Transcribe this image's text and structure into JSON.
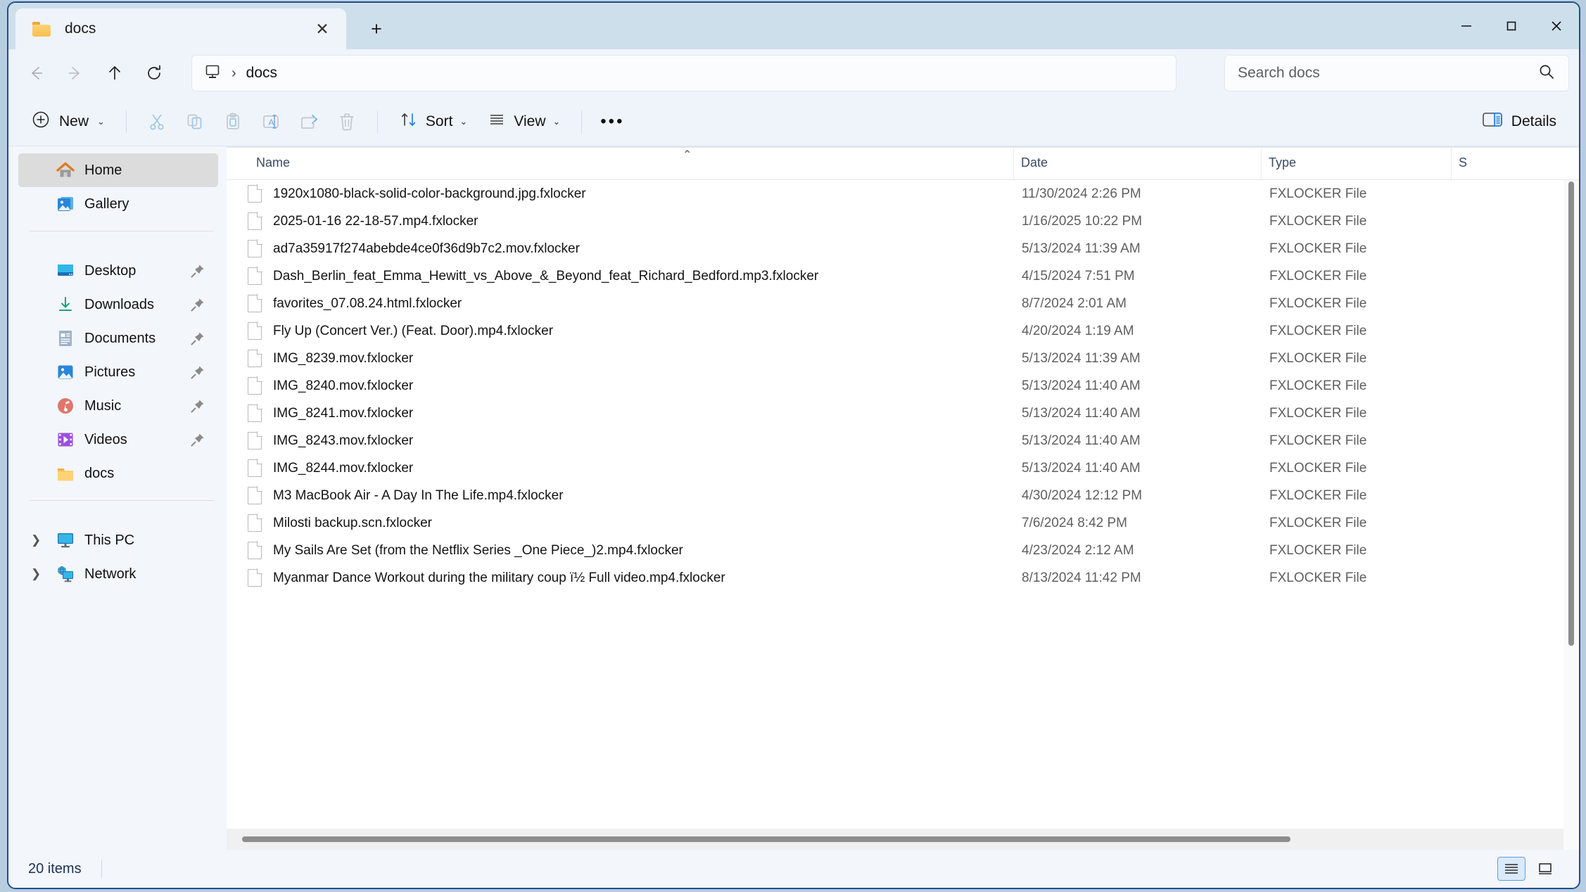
{
  "window": {
    "tab_title": "docs",
    "tab_close_label": "✕",
    "new_tab_label": "+",
    "minimize_label": "minimize",
    "maximize_label": "maximize",
    "close_label": "close"
  },
  "address": {
    "back_label": "Back",
    "forward_label": "Forward",
    "up_label": "Up",
    "refresh_label": "Refresh",
    "breadcrumb_root_icon": "this-pc-icon",
    "breadcrumb_separator": "›",
    "breadcrumb_current": "docs"
  },
  "search": {
    "placeholder": "Search docs",
    "icon": "search-icon"
  },
  "toolbar": {
    "new_label": "New",
    "new_chevron": "⌄",
    "cut_label": "Cut",
    "copy_label": "Copy",
    "paste_label": "Paste",
    "rename_label": "Rename",
    "share_label": "Share",
    "delete_label": "Delete",
    "sort_label": "Sort",
    "sort_chevron": "⌄",
    "view_label": "View",
    "view_chevron": "⌄",
    "more_label": "•••",
    "details_label": "Details"
  },
  "sidebar": {
    "items": [
      {
        "label": "Home",
        "icon": "home-icon",
        "selected": true,
        "pinned": false,
        "expandable": false
      },
      {
        "label": "Gallery",
        "icon": "gallery-icon",
        "selected": false,
        "pinned": false,
        "expandable": false
      },
      {
        "label": "Desktop",
        "icon": "desktop-icon",
        "selected": false,
        "pinned": true,
        "expandable": false
      },
      {
        "label": "Downloads",
        "icon": "downloads-icon",
        "selected": false,
        "pinned": true,
        "expandable": false
      },
      {
        "label": "Documents",
        "icon": "documents-icon",
        "selected": false,
        "pinned": true,
        "expandable": false
      },
      {
        "label": "Pictures",
        "icon": "pictures-icon",
        "selected": false,
        "pinned": true,
        "expandable": false
      },
      {
        "label": "Music",
        "icon": "music-icon",
        "selected": false,
        "pinned": true,
        "expandable": false
      },
      {
        "label": "Videos",
        "icon": "videos-icon",
        "selected": false,
        "pinned": true,
        "expandable": false
      },
      {
        "label": "docs",
        "icon": "folder-icon",
        "selected": false,
        "pinned": false,
        "expandable": false
      },
      {
        "label": "This PC",
        "icon": "this-pc-icon",
        "selected": false,
        "pinned": false,
        "expandable": true
      },
      {
        "label": "Network",
        "icon": "network-icon",
        "selected": false,
        "pinned": false,
        "expandable": true
      }
    ]
  },
  "filelist": {
    "columns": [
      "Name",
      "Date",
      "Type",
      "S"
    ],
    "sort_indicator": "⌃",
    "sorted_column": "Name",
    "rows": [
      {
        "name": "1920x1080-black-solid-color-background.jpg.fxlocker",
        "date": "11/30/2024 2:26 PM",
        "type": "FXLOCKER File"
      },
      {
        "name": "2025-01-16 22-18-57.mp4.fxlocker",
        "date": "1/16/2025 10:22 PM",
        "type": "FXLOCKER File"
      },
      {
        "name": "ad7a35917f274abebde4ce0f36d9b7c2.mov.fxlocker",
        "date": "5/13/2024 11:39 AM",
        "type": "FXLOCKER File"
      },
      {
        "name": "Dash_Berlin_feat_Emma_Hewitt_vs_Above_&_Beyond_feat_Richard_Bedford.mp3.fxlocker",
        "date": "4/15/2024 7:51 PM",
        "type": "FXLOCKER File"
      },
      {
        "name": "favorites_07.08.24.html.fxlocker",
        "date": "8/7/2024 2:01 AM",
        "type": "FXLOCKER File"
      },
      {
        "name": "Fly Up (Concert Ver.) (Feat. Door).mp4.fxlocker",
        "date": "4/20/2024 1:19 AM",
        "type": "FXLOCKER File"
      },
      {
        "name": "IMG_8239.mov.fxlocker",
        "date": "5/13/2024 11:39 AM",
        "type": "FXLOCKER File"
      },
      {
        "name": "IMG_8240.mov.fxlocker",
        "date": "5/13/2024 11:40 AM",
        "type": "FXLOCKER File"
      },
      {
        "name": "IMG_8241.mov.fxlocker",
        "date": "5/13/2024 11:40 AM",
        "type": "FXLOCKER File"
      },
      {
        "name": "IMG_8243.mov.fxlocker",
        "date": "5/13/2024 11:40 AM",
        "type": "FXLOCKER File"
      },
      {
        "name": "IMG_8244.mov.fxlocker",
        "date": "5/13/2024 11:40 AM",
        "type": "FXLOCKER File"
      },
      {
        "name": "M3 MacBook Air - A Day In The Life.mp4.fxlocker",
        "date": "4/30/2024 12:12 PM",
        "type": "FXLOCKER File"
      },
      {
        "name": "Milosti backup.scn.fxlocker",
        "date": "7/6/2024 8:42 PM",
        "type": "FXLOCKER File"
      },
      {
        "name": "My Sails Are Set (from the Netflix Series _One Piece_)2.mp4.fxlocker",
        "date": "4/23/2024 2:12 AM",
        "type": "FXLOCKER File"
      },
      {
        "name": "Myanmar Dance Workout during the military coup ï½ Full video.mp4.fxlocker",
        "date": "8/13/2024 11:42 PM",
        "type": "FXLOCKER File"
      }
    ]
  },
  "statusbar": {
    "item_count": "20 items",
    "details_view_label": "Details view",
    "large_icons_view_label": "Large icons view"
  }
}
